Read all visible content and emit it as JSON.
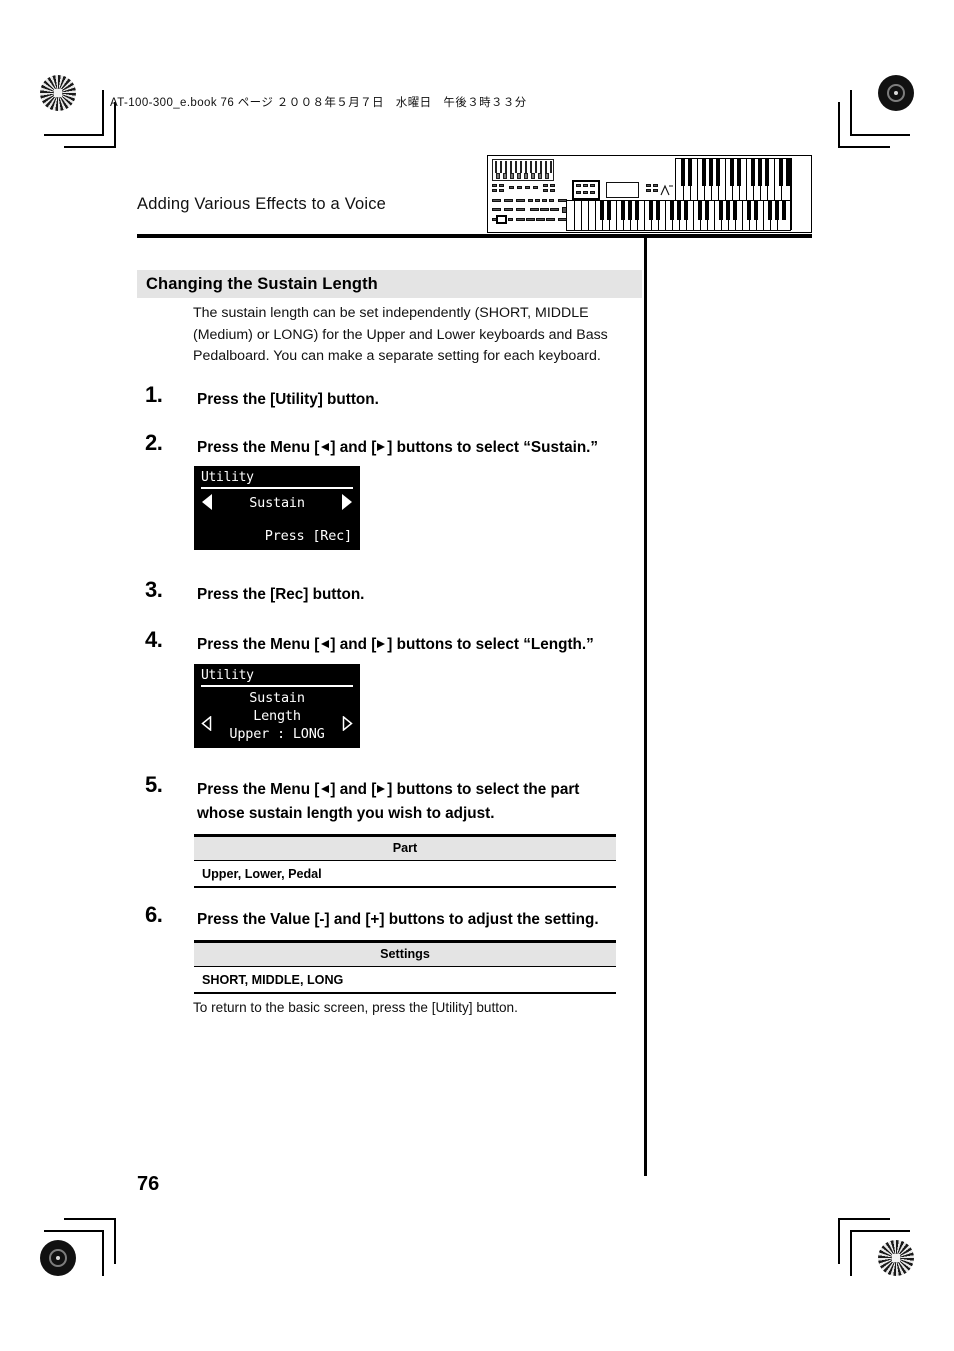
{
  "document": {
    "file_info": "AT-100-300_e.book  76 ページ  ２００８年５月７日　水曜日　午後３時３３分",
    "running_head": "Adding Various Effects to a Voice",
    "page_number": "76"
  },
  "section": {
    "heading": "Changing the Sustain Length",
    "intro": "The sustain length can be set independently (SHORT, MIDDLE (Medium) or LONG) for the Upper and Lower keyboards and Bass Pedalboard. You can make a separate setting for each keyboard."
  },
  "steps": [
    {
      "number": "1.",
      "text_before": "Press the [Utility] button.",
      "text_mid": "",
      "text_after": ""
    },
    {
      "number": "2.",
      "text_before": "Press the Menu [",
      "text_mid": "] and [",
      "text_after": "] buttons to select “Sustain.”"
    },
    {
      "number": "3.",
      "text_before": "Press the [Rec] button.",
      "text_mid": "",
      "text_after": ""
    },
    {
      "number": "4.",
      "text_before": "Press the Menu [",
      "text_mid": "] and [",
      "text_after": "] buttons to select “Length.”"
    },
    {
      "number": "5.",
      "text_before": "Press the Menu [",
      "text_mid": "] and [",
      "text_after": "] buttons to select the part whose sustain length you wish to adjust."
    },
    {
      "number": "6.",
      "text_before": "Press the Value [-] and [+] buttons to adjust the setting.",
      "text_mid": "",
      "text_after": ""
    }
  ],
  "lcd_one": {
    "title": "Utility",
    "center_text": "Sustain",
    "right_text": "Press [Rec]",
    "left_arrow": "left-triangle-solid",
    "right_arrow": "right-triangle-solid"
  },
  "lcd_two": {
    "title": "Utility",
    "line_one": "Sustain",
    "line_two": "Length",
    "line_three": "Upper : LONG",
    "left_arrow": "left-triangle-outline",
    "right_arrow": "right-triangle-outline"
  },
  "table_part": {
    "header": "Part",
    "value": "Upper, Lower, Pedal"
  },
  "table_settings": {
    "header": "Settings",
    "value": "SHORT, MIDDLE, LONG"
  },
  "closing_note": "To return to the basic screen, press the [Utility] button.",
  "colors": {
    "heading_band": "#e4e4e4",
    "table_header": "#e4e4e4",
    "rule": "#000000",
    "lcd_background": "#000000",
    "lcd_text": "#ffffff"
  }
}
